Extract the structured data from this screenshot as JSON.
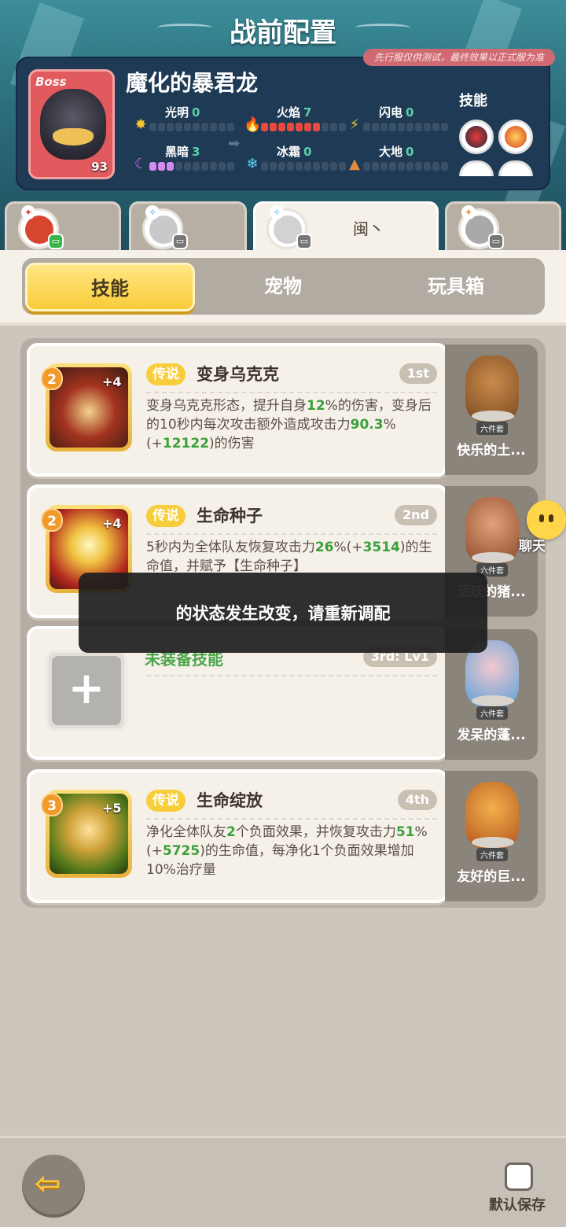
{
  "header": {
    "title": "战前配置",
    "test_banner": "先行服仅供测试，最终效果以正式服为准"
  },
  "boss": {
    "badge": "Boss",
    "name": "魔化的暴君龙",
    "level": "93",
    "skills_label": "技能",
    "elements": [
      {
        "name": "光明",
        "value": "0",
        "icon": "sun-icon",
        "filled": 0
      },
      {
        "name": "火焰",
        "value": "7",
        "icon": "fire-icon",
        "filled": 7
      },
      {
        "name": "闪电",
        "value": "0",
        "icon": "lightning-icon",
        "filled": 0
      },
      {
        "name": "黑暗",
        "value": "3",
        "icon": "moon-icon",
        "filled": 3
      },
      {
        "name": "冰霜",
        "value": "0",
        "icon": "snowflake-icon",
        "filled": 0
      },
      {
        "name": "大地",
        "value": "0",
        "icon": "earth-icon",
        "filled": 0
      }
    ],
    "bar_segments": 10,
    "accent_fire": "#e84a3f",
    "accent_dark": "#d58af0"
  },
  "heroes": [
    {
      "label": "",
      "element": "fire",
      "badge_color": "#3bb54a"
    },
    {
      "label": "",
      "element": "lightning",
      "badge_color": "#777777"
    },
    {
      "label": "闽丶",
      "element": "frost",
      "badge_color": "#777777",
      "active": true
    },
    {
      "label": "",
      "element": "earth",
      "badge_color": "#777777"
    }
  ],
  "tabs": {
    "skills": "技能",
    "pets": "宠物",
    "toybox": "玩具箱"
  },
  "skills": [
    {
      "num": "2",
      "plus": "+4",
      "rarity": "传说",
      "name": "变身乌克克",
      "slot": "1st",
      "desc_parts": [
        "变身乌克克形态，提升自身",
        "12",
        "%的伤害，变身后的10秒内每次攻击额外造成攻击力",
        "90.3",
        "%(+",
        "12122",
        ")的伤害"
      ]
    },
    {
      "num": "2",
      "plus": "+4",
      "rarity": "传说",
      "name": "生命种子",
      "slot": "2nd",
      "desc_parts": [
        "5秒内为全体队友恢复攻击力",
        "26",
        "%(+",
        "3514",
        ")的生命值，并赋予【生命种子】"
      ]
    },
    {
      "empty_label": "未装备技能",
      "slot": "3rd: Lv1"
    },
    {
      "num": "3",
      "plus": "+5",
      "rarity": "传说",
      "name": "生命绽放",
      "slot": "4th",
      "desc_parts": [
        "净化全体队友",
        "2",
        "个负面效果，并恢复攻击力",
        "51",
        "%(+",
        "5725",
        ")的生命值，每净化1个负面效果增加10%治疗量"
      ]
    }
  ],
  "pets": [
    {
      "name": "快乐的土...",
      "badge": "六件套"
    },
    {
      "name": "活跃的猪...",
      "badge": "六件套"
    },
    {
      "name": "发呆的蓬...",
      "badge": "六件套"
    },
    {
      "name": "友好的巨...",
      "badge": "六件套"
    }
  ],
  "toast": "的状态发生改变，请重新调配",
  "chat": "聊天",
  "bottom": {
    "save_label": "默认保存"
  }
}
